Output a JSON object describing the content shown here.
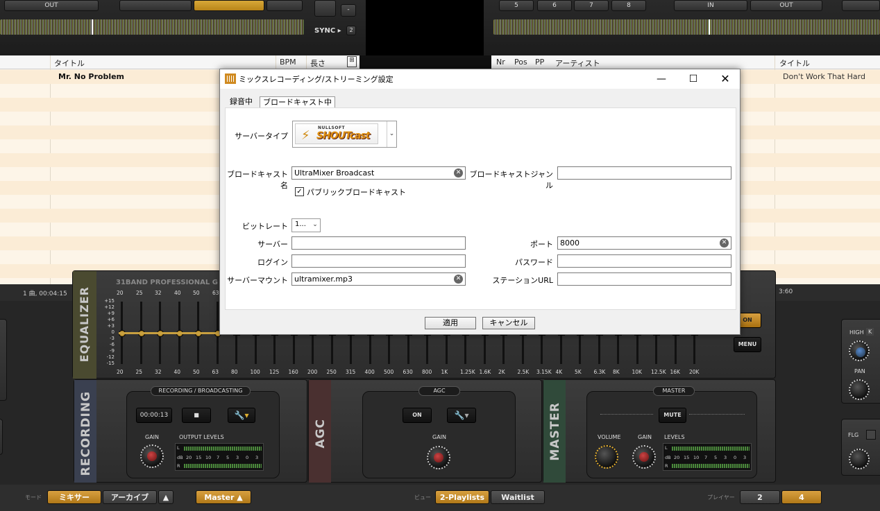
{
  "deck_left": {
    "out_label": "OUT",
    "sync_label": "SYNC ▸",
    "sync_num": "2",
    "minus": "-"
  },
  "deck_right": {
    "nums": [
      "5",
      "6",
      "7",
      "8"
    ],
    "in_label": "IN",
    "out_label": "OUT"
  },
  "playlist_left": {
    "columns": [
      "タイトル",
      "BPM",
      "長さ"
    ],
    "rows": [
      {
        "title": "Mr. No Problem"
      }
    ],
    "status": "1 曲, 00:04:15"
  },
  "playlist_right": {
    "columns": [
      "Nr",
      "Pos",
      "PP",
      "アーティスト",
      "タイトル"
    ],
    "rows": [
      {
        "title": "Don't Work That Hard"
      }
    ],
    "status": "3:60"
  },
  "dialog": {
    "title": "ミックスレコーディング/ストリーミング設定",
    "tabs": [
      "録音中",
      "ブロードキャスト中"
    ],
    "server_type_label": "サーバータイプ",
    "server_type_value": {
      "small": "NULLSOFT",
      "big": "SHOUTcast"
    },
    "broadcast_name_label": "ブロードキャスト名",
    "broadcast_name_value": "UltraMixer Broadcast",
    "broadcast_genre_label": "ブロードキャストジャンル",
    "broadcast_genre_value": "",
    "public_label": "パブリックブロードキャスト",
    "public_checked": "✓",
    "bitrate_label": "ビットレート",
    "bitrate_value": "1...",
    "server_label": "サーバー",
    "server_value": "",
    "port_label": "ポート",
    "port_value": "8000",
    "login_label": "ログイン",
    "login_value": "",
    "password_label": "パスワード",
    "password_value": "",
    "mount_label": "サーバーマウント",
    "mount_value": "ultramixer.mp3",
    "station_url_label": "ステーションURL",
    "station_url_value": "",
    "apply": "適用",
    "cancel": "キャンセル"
  },
  "equalizer": {
    "side_label": "EQUALIZER",
    "title": "31BAND PROFESSIONAL G",
    "top_freqs": [
      "20",
      "25",
      "32",
      "40",
      "50",
      "63"
    ],
    "scale": [
      "+15",
      "+12",
      "+9",
      "+6",
      "+3",
      "0",
      "-3",
      "-6",
      "-9",
      "-12",
      "-15"
    ],
    "freqs": [
      "20",
      "25",
      "32",
      "40",
      "50",
      "63",
      "80",
      "100",
      "125",
      "160",
      "200",
      "250",
      "315",
      "400",
      "500",
      "630",
      "800",
      "1K",
      "1.25K",
      "1.6K",
      "2K",
      "2.5K",
      "3.15K",
      "4K",
      "5K",
      "6.3K",
      "8K",
      "10K",
      "12.5K",
      "16K",
      "20K"
    ],
    "on": "ON",
    "menu": "MENU"
  },
  "recording": {
    "side_label": "RECORDING",
    "title": "RECORDING / BROADCASTING",
    "time": "00:00:13",
    "gain": "GAIN",
    "levels": "OUTPUT LEVELS"
  },
  "agc": {
    "side_label": "AGC",
    "title": "AGC",
    "on": "ON",
    "gain": "GAIN"
  },
  "master": {
    "side_label": "MASTER",
    "title": "MASTER",
    "mute": "MUTE",
    "volume": "VOLUME",
    "gain": "GAIN",
    "levels": "LEVELS"
  },
  "meter_scale": [
    "20",
    "15",
    "10",
    "7",
    "5",
    "3",
    "0",
    "3"
  ],
  "meter_lr": {
    "l": "L",
    "db": "dB",
    "r": "R"
  },
  "right_knobs": {
    "high": "HIGH",
    "k": "K",
    "pan": "PAN",
    "flg": "FLG"
  },
  "bottom": {
    "mode_label": "モード",
    "mixer": "ミキサー",
    "archive": "アーカイブ",
    "master": "Master ▲",
    "view_label": "ビュー",
    "playlists": "2-Playlists",
    "waitlist": "Waitlist",
    "player_label": "プレイヤー",
    "p2": "2",
    "p4": "4"
  }
}
